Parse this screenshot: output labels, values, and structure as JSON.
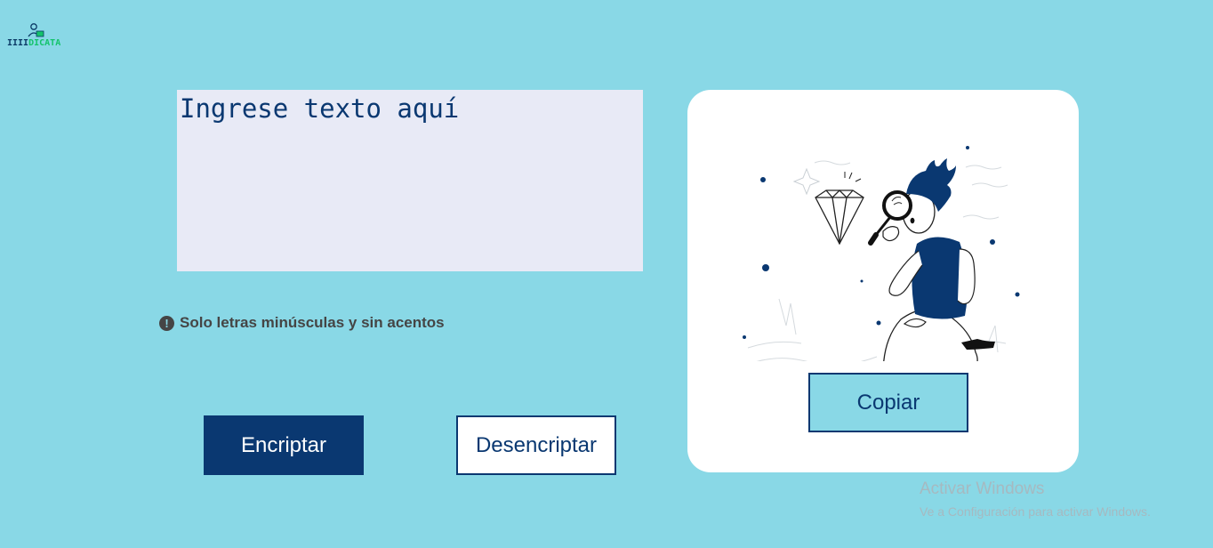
{
  "logo": {
    "icon": "person-laptop-logo-icon",
    "text_main": "IIII",
    "text_accent": "DICATA"
  },
  "input": {
    "placeholder": "Ingrese texto aquí"
  },
  "warning": {
    "icon": "exclamation-circle-icon",
    "text": "Solo letras minúsculas y sin acentos"
  },
  "buttons": {
    "encrypt_label": "Encriptar",
    "decrypt_label": "Desencriptar",
    "copy_label": "Copiar"
  },
  "output": {
    "illustration": "person-with-magnifying-glass-and-diamond-illustration"
  },
  "watermark": {
    "title": "Activar Windows",
    "subtitle": "Ve a Configuración para activar Windows."
  },
  "colors": {
    "background": "#89d8e6",
    "primary": "#0a3871",
    "input_bg": "#e8eaf6",
    "panel_bg": "#ffffff",
    "warning_text": "#454545"
  }
}
